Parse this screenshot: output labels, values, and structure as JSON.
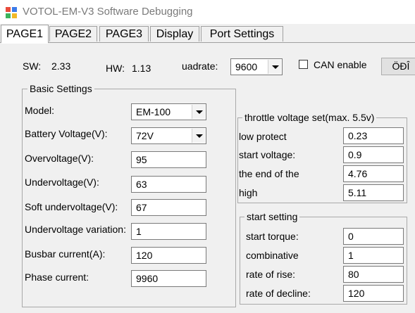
{
  "window": {
    "title": "VOTOL-EM-V3 Software Debugging",
    "icon": "app-blocks-icon"
  },
  "tabs": [
    {
      "label": "PAGE1",
      "active": true
    },
    {
      "label": "PAGE2",
      "active": false
    },
    {
      "label": "PAGE3",
      "active": false
    },
    {
      "label": "Display",
      "active": false
    },
    {
      "label": "Port Settings",
      "active": false
    }
  ],
  "info": {
    "sw_label": "SW:",
    "sw_value": "2.33",
    "hw_label": "HW:",
    "hw_value": "1.13",
    "baud_label": "uadrate:",
    "baud_value": "9600",
    "can_label": "CAN enable",
    "can_checked": false,
    "button_label": "ÖĐÎ"
  },
  "basic": {
    "legend": "Basic Settings",
    "model_label": "Model:",
    "model_value": "EM-100",
    "battery_label": "Battery Voltage(V):",
    "battery_value": "72V",
    "overvoltage_label": "Overvoltage(V):",
    "overvoltage_value": "95",
    "undervoltage_label": "Undervoltage(V):",
    "undervoltage_value": "63",
    "soft_label": "Soft undervoltage(V):",
    "soft_value": "67",
    "variation_label": "Undervoltage variation:",
    "variation_value": "1",
    "busbar_label": "Busbar current(A):",
    "busbar_value": "120",
    "phase_label": "Phase current:",
    "phase_value": "9960"
  },
  "throttle": {
    "legend": "throttle voltage set(max. 5.5v)",
    "low_protect_label": "low protect",
    "low_protect_value": "0.23",
    "start_voltage_label": "start voltage:",
    "start_voltage_value": "0.9",
    "end_label": "the end of the",
    "end_value": "4.76",
    "high_label": "high",
    "high_value": "5.11"
  },
  "start": {
    "legend": "start setting",
    "torque_label": "start torque:",
    "torque_value": "0",
    "combinative_label": "combinative",
    "combinative_value": "1",
    "rise_label": "rate of rise:",
    "rise_value": "80",
    "decline_label": "rate of decline:",
    "decline_value": "120"
  },
  "colors": {
    "window_bg": "#f0f0f0",
    "title_text": "#7a7a7a",
    "field_border": "#7a7a7a",
    "frame_border": "#a9a9a9"
  }
}
